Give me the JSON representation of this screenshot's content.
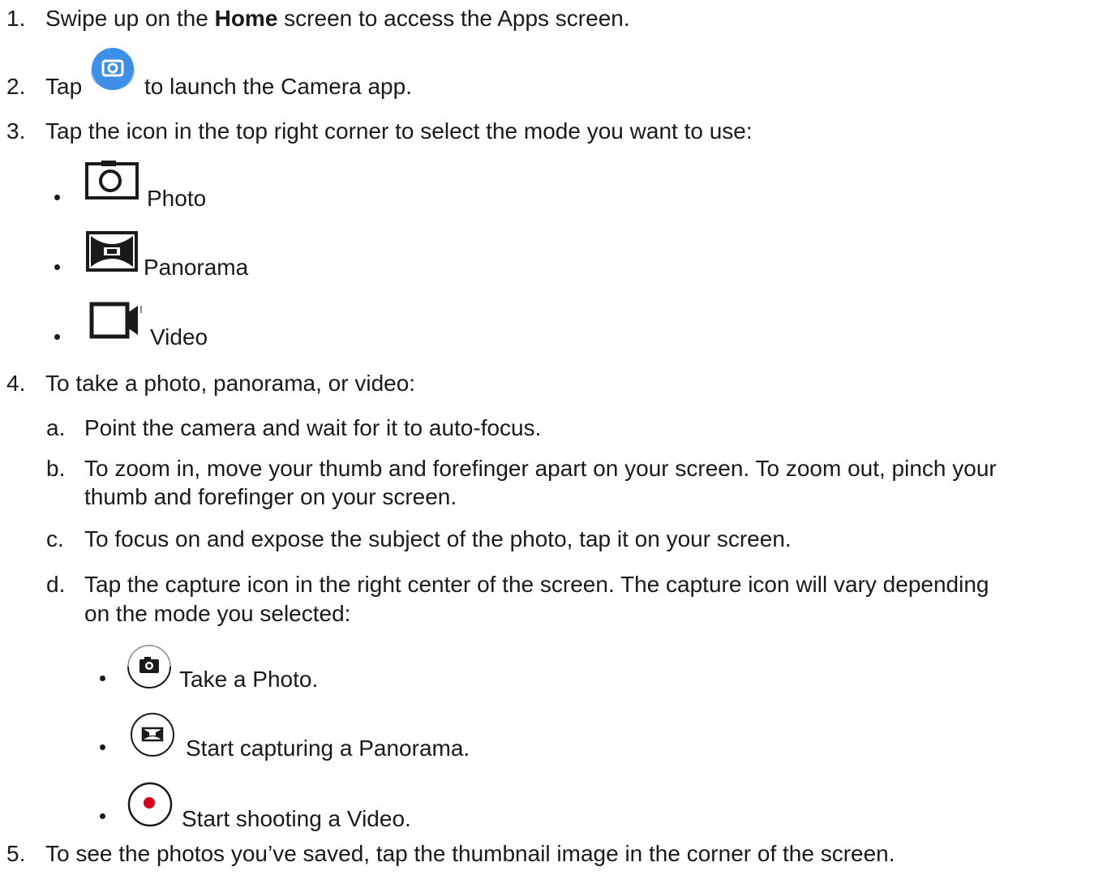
{
  "steps": [
    {
      "num": "1.",
      "pre": "Swipe up on the ",
      "bold": "Home",
      "post": " screen to access the Apps screen."
    },
    {
      "num": "2.",
      "pre": "Tap",
      "post": "to launch the Camera app.",
      "icon": "camera-app-icon"
    },
    {
      "num": "3.",
      "text": "Tap the icon in the top right corner to select the mode you want to use:"
    },
    {
      "num": "4.",
      "text": "To take a photo, panorama, or video:"
    },
    {
      "num": "5.",
      "text": "To see the photos you’ve saved, tap the thumbnail image in the corner of the screen."
    }
  ],
  "modes": [
    {
      "icon": "photo-mode-icon",
      "label": "Photo"
    },
    {
      "icon": "panorama-mode-icon",
      "label": "Panorama"
    },
    {
      "icon": "video-mode-icon",
      "label": "Video"
    }
  ],
  "substeps": [
    {
      "letter": "a.",
      "lines": [
        "Point the camera and wait for it to auto-focus."
      ]
    },
    {
      "letter": "b.",
      "lines": [
        "To zoom in, move your thumb and forefinger apart on your screen. To zoom out, pinch your",
        "thumb and forefinger on your screen."
      ]
    },
    {
      "letter": "c.",
      "lines": [
        "To focus on and expose the subject of the photo, tap it on your screen."
      ]
    },
    {
      "letter": "d.",
      "lines": [
        "Tap the capture icon in the right center of the screen. The capture icon will vary depending",
        "on the mode you selected:"
      ]
    }
  ],
  "captures": [
    {
      "icon": "photo-capture-icon",
      "label": "Take a Photo."
    },
    {
      "icon": "panorama-capture-icon",
      "label": "Start capturing a Panorama."
    },
    {
      "icon": "video-capture-icon",
      "label": "Start shooting a Video."
    }
  ],
  "colors": {
    "camera_app": "#3d8fe8",
    "record": "#d0021b"
  }
}
